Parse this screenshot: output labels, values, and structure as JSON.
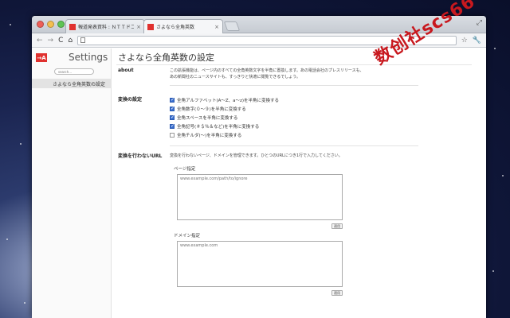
{
  "tabs": [
    {
      "label": "報道発表資料 : ＮＴＴドコモと"
    },
    {
      "label": "さよなら全角英数"
    }
  ],
  "sidebar": {
    "title": "Settings",
    "search_placeholder": "search...",
    "item": "さよなら全角英数の設定"
  },
  "page": {
    "title": "さよなら全角英数の設定",
    "about": {
      "label": "about",
      "text1": "この拡張機能は、ページ内のすべての全角英数文字を半角に置換します。あの電話会社のプレスリリースも、",
      "text2": "あの新聞社のニュースサイトも、すっきりと快適に閲覧できるでしょう。"
    },
    "conversion": {
      "label": "変換の設定",
      "options": [
        {
          "label": "全角アルファベット(A〜Z、a〜z)を半角に変換する",
          "checked": true
        },
        {
          "label": "全角数字(０〜９)を半角に変換する",
          "checked": true
        },
        {
          "label": "全角スペースを半角に変換する",
          "checked": true
        },
        {
          "label": "全角記号(＃＄％＆など)を半角に変換する",
          "checked": true
        },
        {
          "label": "全角チルダ(〜)を半角に変換する",
          "checked": false
        }
      ]
    },
    "exclude": {
      "label": "変換を行わないURL",
      "description": "変換を行わないページ、ドメインを管理できます。ひとつのURLにつき1行で入力してください。",
      "page_label": "ページ指定",
      "page_placeholder": "www.example.com/path/to/ignore",
      "domain_label": "ドメイン指定",
      "domain_placeholder": "www.example.com",
      "apply": "適用"
    }
  },
  "watermark": "数创社scs66",
  "colors": {
    "accent": "#e0312f",
    "checkbox": "#3a6fd1"
  }
}
